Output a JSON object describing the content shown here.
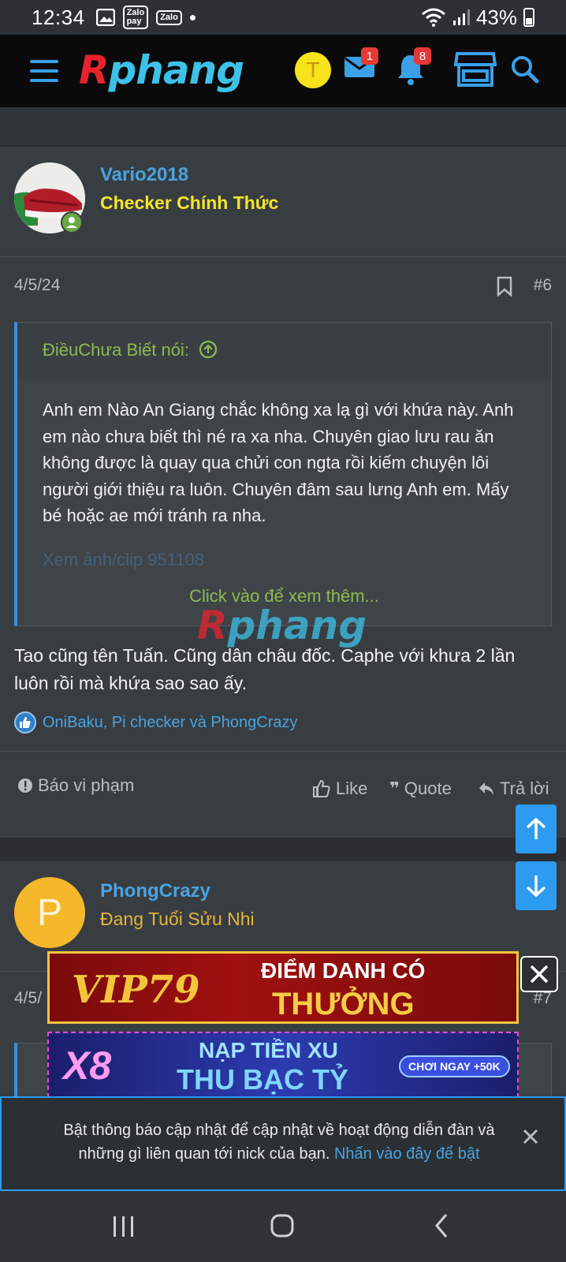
{
  "status_bar": {
    "time": "12:34",
    "battery": "43%",
    "zalo_label": "Zalo pay"
  },
  "header": {
    "logo_first": "R",
    "logo_rest": "phang",
    "user_initial": "T",
    "messages_count": "1",
    "notifications_count": "8"
  },
  "post1": {
    "username": "Vario2018",
    "user_title": "Checker Chính Thức",
    "date": "4/5/24",
    "number": "#6",
    "quote_author": "ĐiềuChưa Biết nói:",
    "quote_text": "Anh em Nào An Giang chắc không xa lạ gì với khứa này. Anh em nào chưa biết thì né ra xa nha. Chuyên giao lưu rau ăn không được là quay qua chửi con ngta rồi kiếm chuyện lôi người giới thiệu ra luôn. Chuyên đâm sau lưng Anh em. Mấy bé hoặc ae mới tránh ra nha.",
    "quote_media": "Xem ảnh/clip 951108",
    "click_more": "Click vào để xem thêm...",
    "body": "Tao cũng tên Tuấn. Cũng dân châu đốc. Caphe với khưa 2 lần luôn rồi mà khứa sao sao ấy.",
    "reactions": "OniBaku, Pi checker và PhongCrazy",
    "actions": {
      "report": "Báo vi phạm",
      "like": "Like",
      "quote": "Quote",
      "reply": "Trả lời"
    }
  },
  "post2": {
    "avatar_initial": "P",
    "username": "PhongCrazy",
    "user_title": "Đang Tuổi Sửu Nhi",
    "date": "4/5/",
    "number": "#7"
  },
  "ads": {
    "ad1_brand": "VIP79",
    "ad1_line1": "ĐIỂM DANH CÓ",
    "ad1_line2": "THƯỞNG",
    "ad2_brand": "X8",
    "ad2_line1": "NẠP TIỀN XU",
    "ad2_line2": "THU BẠC TỶ",
    "ad2_cta": "CHƠI NGAY +50K"
  },
  "notice": {
    "text": "Bật thông báo cập nhật để cập nhật về hoạt động diễn đàn và những gì liên quan tới nick của bạn.",
    "link": "Nhấn vào đây để bật"
  },
  "colors": {
    "accent": "#2d9cf0",
    "username": "#4aa3e0",
    "title_yellow": "#f5e62a",
    "title_orange": "#e5b53a",
    "quote_green": "#8dbb4f"
  }
}
